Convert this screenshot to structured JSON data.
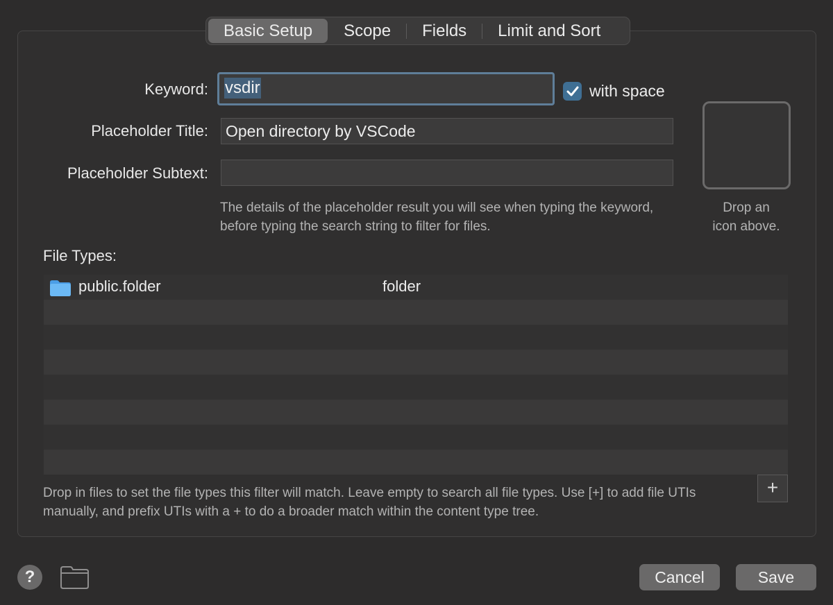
{
  "tabs": [
    "Basic Setup",
    "Scope",
    "Fields",
    "Limit and Sort"
  ],
  "active_tab": "Basic Setup",
  "form": {
    "keyword_label": "Keyword:",
    "keyword_value": "vsdir",
    "with_space_label": "with space",
    "with_space_checked": true,
    "placeholder_title_label": "Placeholder Title:",
    "placeholder_title_value": "Open directory by VSCode",
    "placeholder_subtext_label": "Placeholder Subtext:",
    "placeholder_subtext_value": "",
    "placeholder_description": "The details of the placeholder result you will see when typing the keyword, before typing the search string to filter for files."
  },
  "icon_well": {
    "hint_line1": "Drop an",
    "hint_line2": "icon above."
  },
  "file_types": {
    "label": "File Types:",
    "rows": [
      {
        "uti": "public.folder",
        "type": "folder",
        "icon": "folder-icon"
      }
    ],
    "help_text": "Drop in files to set the file types this filter will match. Leave empty to search all file types. Use [+] to add file UTIs manually, and prefix UTIs with a + to do a broader match within the content type tree.",
    "add_button_label": "+"
  },
  "footer": {
    "help_label": "?",
    "cancel_label": "Cancel",
    "save_label": "Save"
  },
  "colors": {
    "background": "#2d2c2c",
    "accent": "#3f6f94",
    "folder_blue": "#5aaef0"
  }
}
